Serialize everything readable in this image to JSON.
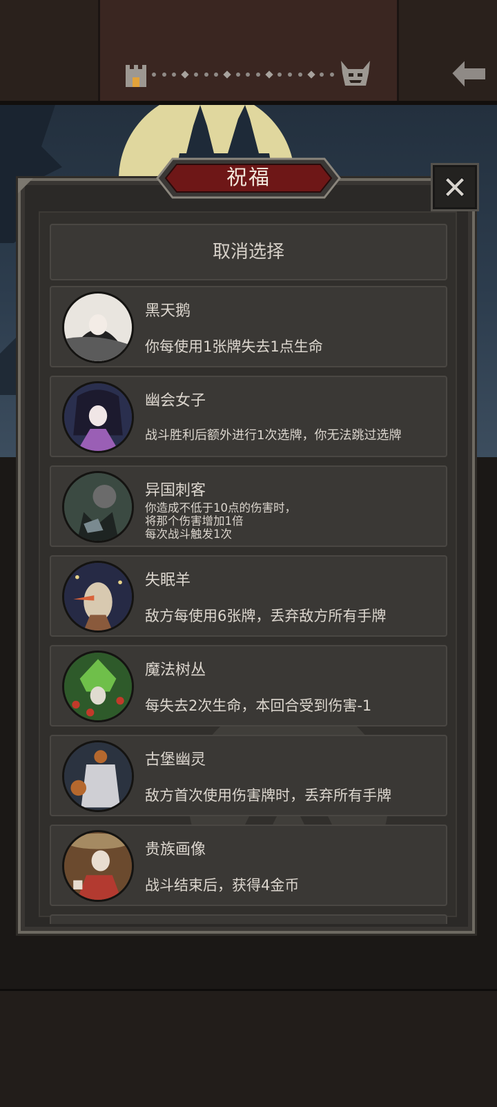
{
  "dialog": {
    "title": "祝福",
    "cancel_label": "取消选择",
    "close_icon": "close-icon"
  },
  "progress": {
    "start_icon": "castle-icon",
    "end_icon": "boss-icon",
    "back_icon": "back-arrow-icon"
  },
  "blessings": [
    {
      "name": "黑天鹅",
      "desc": "你每使用1张牌失去1点生命",
      "portrait_colors": [
        "#e9e5df",
        "#222",
        "#5b5b5b"
      ]
    },
    {
      "name": "幽会女子",
      "desc": "战斗胜利后额外进行1次选牌，你无法跳过选牌",
      "portrait_colors": [
        "#2a2f4e",
        "#9a5fb5",
        "#f0e6e6"
      ]
    },
    {
      "name": "异国刺客",
      "desc_lines": [
        "你造成不低于10点的伤害时，",
        "将那个伤害增加1倍",
        "每次战斗触发1次"
      ],
      "portrait_colors": [
        "#3b4a42",
        "#6b6b6b",
        "#1e2422"
      ]
    },
    {
      "name": "失眠羊",
      "desc": "敌方每使用6张牌，丢弃敌方所有手牌",
      "portrait_colors": [
        "#262a45",
        "#d8c9b0",
        "#8a5a3c"
      ]
    },
    {
      "name": "魔法树丛",
      "desc": "每失去2次生命，本回合受到伤害-1",
      "portrait_colors": [
        "#2e5a2a",
        "#6fbf4a",
        "#c23a2a"
      ]
    },
    {
      "name": "古堡幽灵",
      "desc": "敌方首次使用伤害牌时，丢弃所有手牌",
      "portrait_colors": [
        "#2b3340",
        "#cfcfd4",
        "#b5682e"
      ]
    },
    {
      "name": "贵族画像",
      "desc": "战斗结束后，获得4金币",
      "portrait_colors": [
        "#6b4a2e",
        "#b33a30",
        "#e8ddd0"
      ]
    }
  ]
}
